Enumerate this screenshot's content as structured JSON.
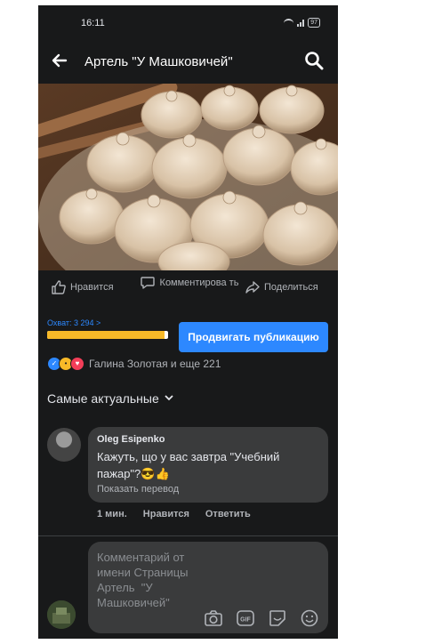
{
  "status": {
    "time": "16:11",
    "battery": "97"
  },
  "header": {
    "title": "Артель  \"У Машковичей\""
  },
  "post": {
    "actions": {
      "like": "Нравится",
      "comment": "Комментирова ть",
      "share": "Поделиться"
    },
    "reach": {
      "label": "Охват: 3 294 >",
      "progress": 0.97
    },
    "promote_label": "Продвигать публикацию",
    "reactions_text": "Галина Золотая и еще 221"
  },
  "comments": {
    "sort_label": "Самые актуальные",
    "items": [
      {
        "author": "Oleg Esipenko",
        "text": "Кажуть, що у вас завтра \"Учебний пажар\"?",
        "emoji": "😎👍",
        "translate": "Показать перевод",
        "time": "1 мин.",
        "like": "Нравится",
        "reply": "Ответить"
      }
    ]
  },
  "composer": {
    "placeholder": "Комментарий от имени Страницы Артель  \"У Машковичей\""
  },
  "colors": {
    "background": "#18191a",
    "accent": "#2d88ff",
    "bubble": "#3a3b3c",
    "reach_fill": "#f7b928"
  },
  "icons": [
    "back-arrow-icon",
    "search-icon",
    "like-icon",
    "comment-icon",
    "share-icon",
    "camera-icon",
    "gif-icon",
    "sticker-icon",
    "emoji-icon"
  ]
}
